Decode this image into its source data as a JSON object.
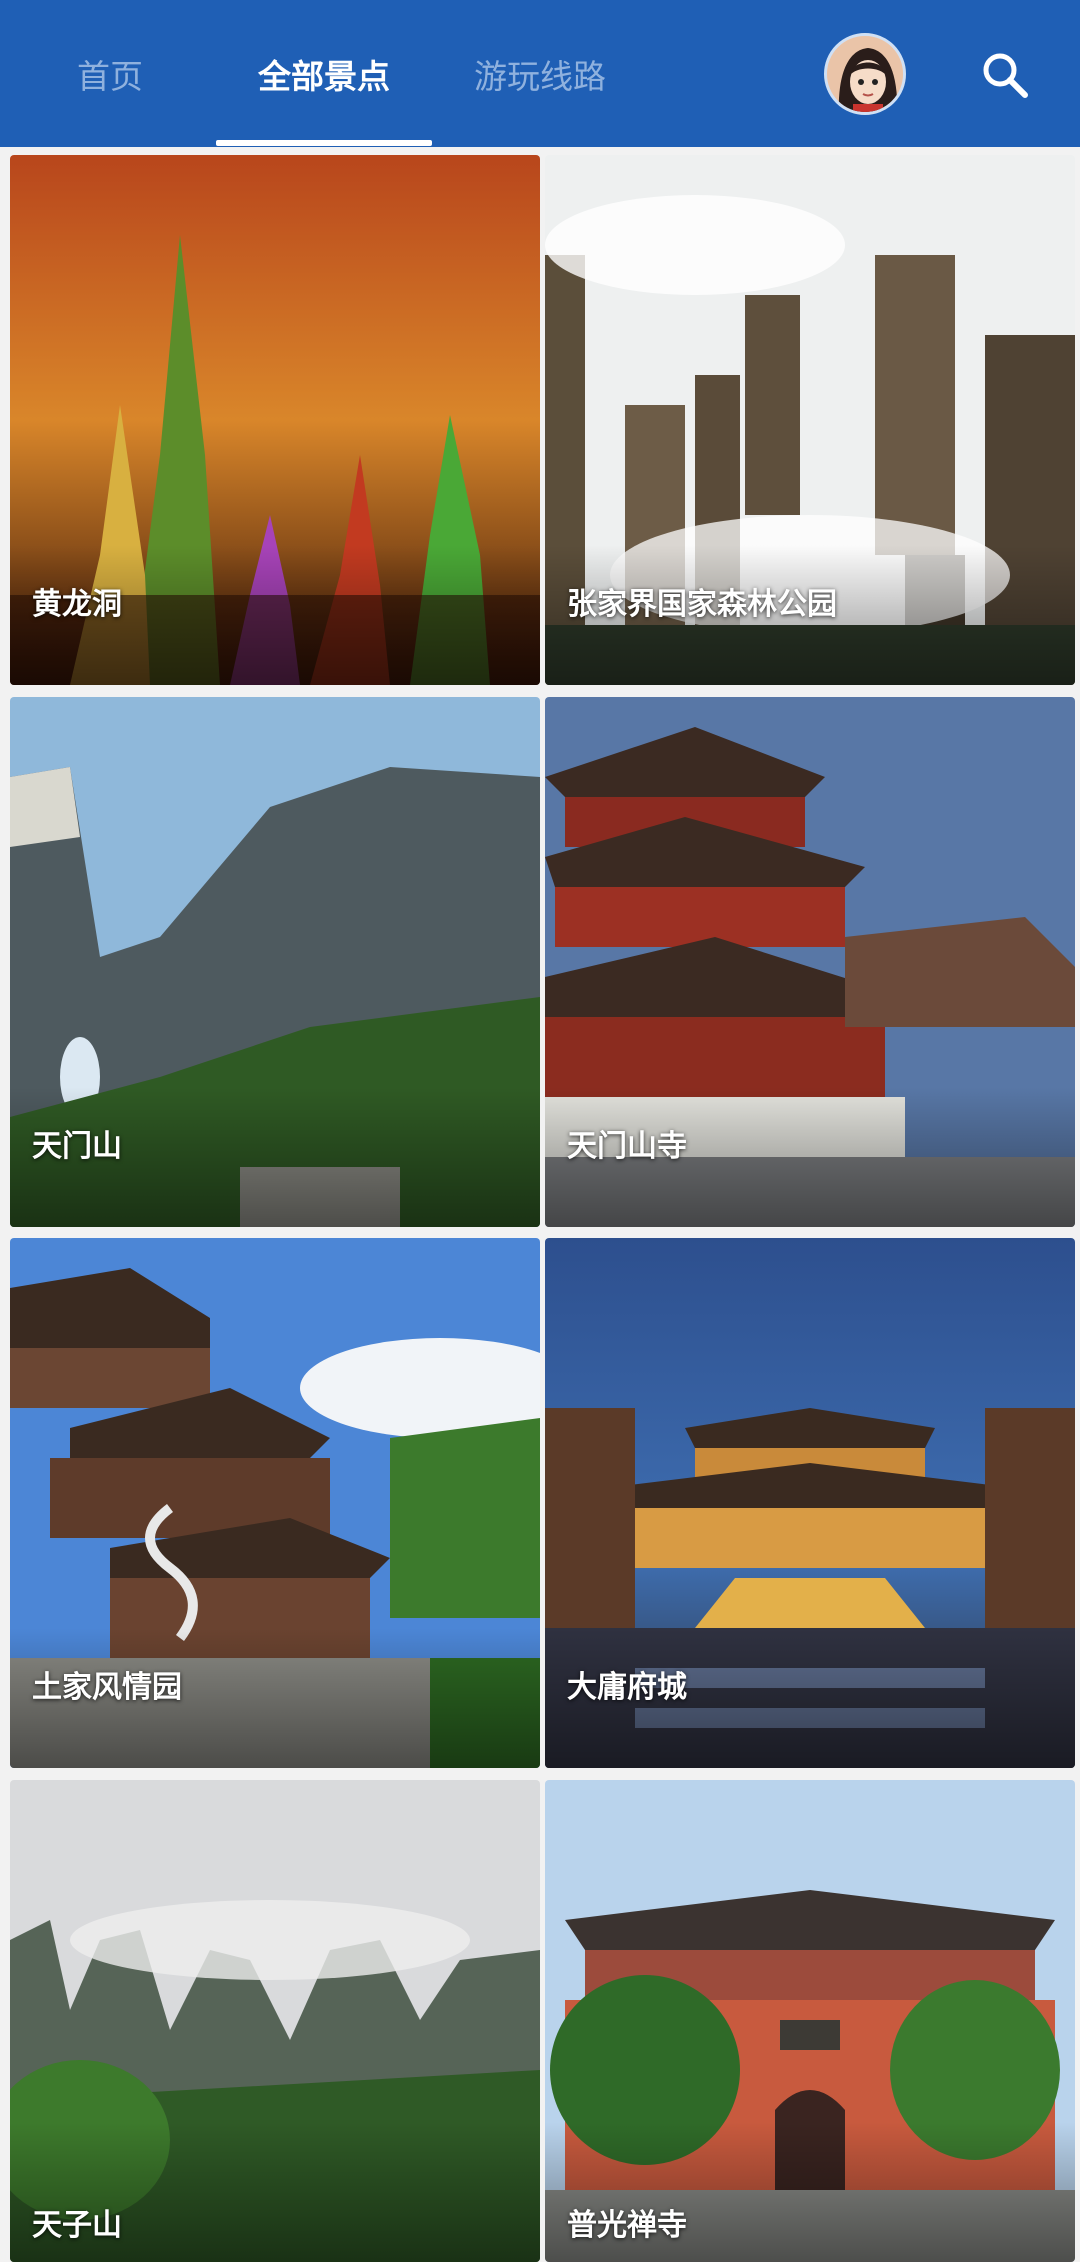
{
  "nav": {
    "tabs": [
      {
        "label": "首页",
        "active": false
      },
      {
        "label": "全部景点",
        "active": true
      },
      {
        "label": "游玩线路",
        "active": false
      }
    ],
    "avatar_icon": "user-avatar",
    "search_icon": "search-icon",
    "colors": {
      "bar": "#1f5fb5",
      "active": "#ffffff",
      "inactive": "#8fb1de"
    }
  },
  "attractions": [
    {
      "name": "黄龙洞"
    },
    {
      "name": "张家界国家森林公园"
    },
    {
      "name": "天门山"
    },
    {
      "name": "天门山寺"
    },
    {
      "name": "土家风情园"
    },
    {
      "name": "大庸府城"
    },
    {
      "name": "天子山"
    },
    {
      "name": "普光禅寺"
    }
  ]
}
